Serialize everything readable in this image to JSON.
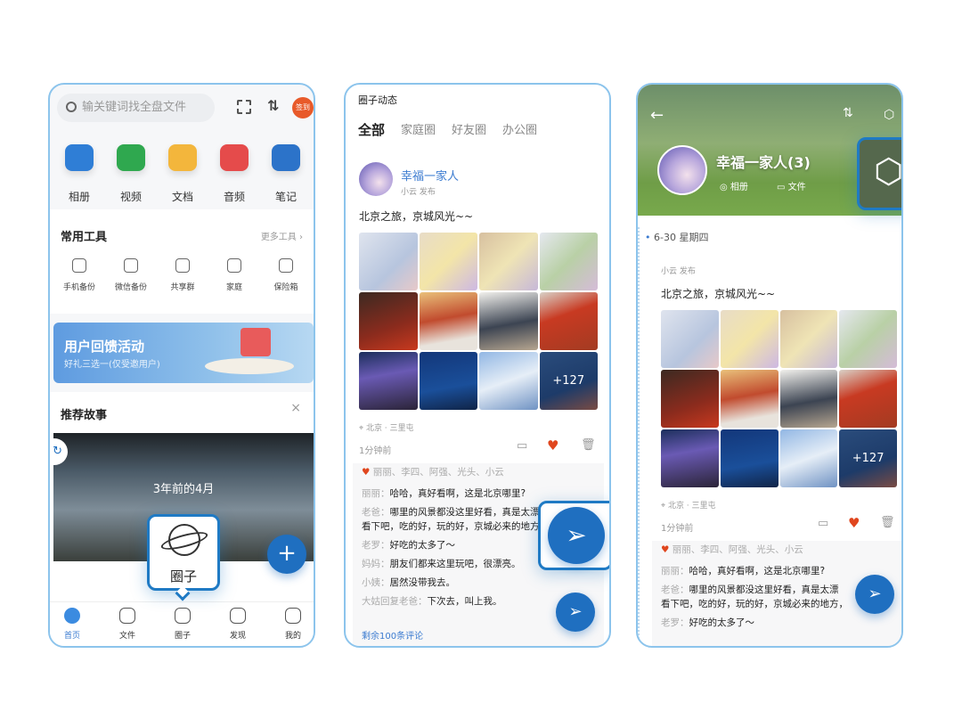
{
  "home": {
    "search_placeholder": "输关键词找全盘文件",
    "badge": "签到",
    "categories": [
      {
        "label": "相册",
        "color": "#2f7ed6"
      },
      {
        "label": "视频",
        "color": "#2fa84f"
      },
      {
        "label": "文档",
        "color": "#f3b63c"
      },
      {
        "label": "音频",
        "color": "#e54b4b"
      },
      {
        "label": "笔记",
        "color": "#2c73c9"
      }
    ],
    "tools_title": "常用工具",
    "more_tools": "更多工具 ›",
    "tools": [
      "手机备份",
      "微信备份",
      "共享群",
      "家庭",
      "保险箱"
    ],
    "banner_title": "用户回馈活动",
    "banner_sub": "好礼三选一(仅受邀用户)",
    "story_title": "推荐故事",
    "story_caption": "3年前的4月",
    "callout_label": "圈子",
    "nav": [
      {
        "label": "首页",
        "icon": "home-icon",
        "active": true
      },
      {
        "label": "文件",
        "icon": "folder-icon"
      },
      {
        "label": "圈子",
        "icon": "planet-icon"
      },
      {
        "label": "发现",
        "icon": "compass-icon"
      },
      {
        "label": "我的",
        "icon": "profile-icon"
      }
    ]
  },
  "feed": {
    "title": "圈子动态",
    "tabs": [
      "全部",
      "家庭圈",
      "好友圈",
      "办公圈"
    ],
    "circle_name": "幸福一家人",
    "poster": "小云 发布",
    "post_text": "北京之旅，京城风光~~",
    "more_photos": "+127",
    "location": "北京 · 三里屯",
    "time": "1分钟前",
    "likes": "丽丽、李四、阿强、光头、小云",
    "comments": [
      {
        "name": "丽丽：",
        "text": "哈哈，真好看啊，这是北京哪里?"
      },
      {
        "name": "老爸：",
        "text": "哪里的风景都没这里好看，真是太漂"
      },
      {
        "name": "",
        "text": "看下吧，吃的好，玩的好，京城必来的地方，"
      },
      {
        "name": "老罗：",
        "text": "好吃的太多了～"
      },
      {
        "name": "妈妈：",
        "text": "朋友们都来这里玩吧，很漂亮。"
      },
      {
        "name": "小姨：",
        "text": "居然没带我去。"
      },
      {
        "name": "大姑回复老爸：",
        "text": "下次去，叫上我。"
      }
    ],
    "remaining": "剩余100条评论"
  },
  "detail": {
    "title": "幸福一家人(3)",
    "album": "相册",
    "files": "文件",
    "date": "6-30 星期四",
    "poster": "小云 发布",
    "post_text": "北京之旅，京城风光~~",
    "more_photos": "+127",
    "location": "北京 · 三里屯",
    "time": "1分钟前",
    "likes": "丽丽、李四、阿强、光头、小云",
    "comments": [
      {
        "name": "丽丽：",
        "text": "哈哈，真好看啊，这是北京哪里?"
      },
      {
        "name": "老爸：",
        "text": "哪里的风景都没这里好看，真是太漂"
      },
      {
        "name": "",
        "text": "看下吧，吃的好，玩的好，京城必来的地方，"
      },
      {
        "name": "老罗：",
        "text": "好吃的太多了～"
      }
    ]
  },
  "colors": {
    "accent": "#1f6fc0",
    "like": "#e0461e",
    "border": "#8cc4ec"
  }
}
